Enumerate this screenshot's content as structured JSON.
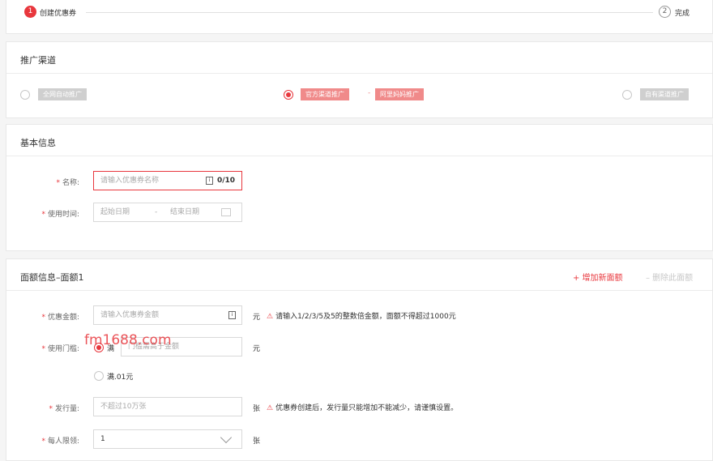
{
  "steps": {
    "step1_num": "1",
    "step1_label": "创建优惠券",
    "step2_num": "2",
    "step2_label": "完成"
  },
  "channel": {
    "title": "推广渠道",
    "opt1": "全网自动推广",
    "opt2": "官方渠道推广",
    "opt2_sep": "-",
    "opt2_sub": "阿里妈妈推广",
    "opt3": "自有渠道推广",
    "selected": "官方渠道推广"
  },
  "basic": {
    "title": "基本信息",
    "name_label": "名称:",
    "name_placeholder": "请输入优惠券名称",
    "name_counter": "0/10",
    "time_label": "使用时间:",
    "start_placeholder": "起始日期",
    "dash": "-",
    "end_placeholder": "结束日期"
  },
  "denomination": {
    "title": "面额信息–面额1",
    "add_label": "+ 增加新面额",
    "delete_label": "– 删除此面额",
    "amount_label": "优惠金额:",
    "amount_placeholder": "请输入优惠券金额",
    "amount_unit": "元",
    "amount_warning": "请输入1/2/3/5及5的整数倍金额，面额不得超过1000元",
    "threshold_label": "使用门槛:",
    "threshold_opt1": "满",
    "threshold_placeholder": "门槛需高于金额",
    "threshold_unit": "元",
    "threshold_opt2": "满.01元",
    "issue_label": "发行量:",
    "issue_placeholder": "不超过10万张",
    "issue_unit": "张",
    "issue_warning": "优惠券创建后，发行量只能增加不能减少，请谨慎设置。",
    "limit_label": "每人限领:",
    "limit_value": "1",
    "limit_unit": "张"
  },
  "watermark": "fm1688.com",
  "colors": {
    "accent": "#e8373d",
    "tag_grey": "#cfcfcf",
    "tag_red": "#f08a8a"
  }
}
